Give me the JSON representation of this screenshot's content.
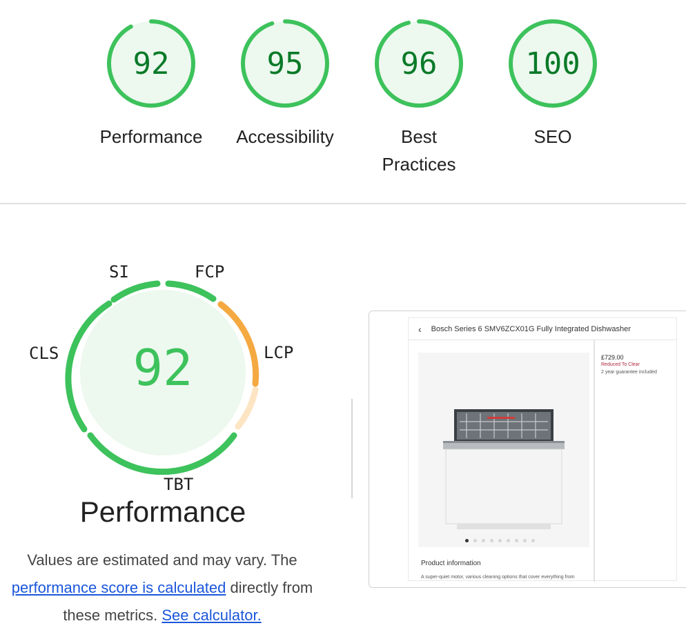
{
  "categories": [
    {
      "score": "92",
      "label": "Performance"
    },
    {
      "score": "95",
      "label": "Accessibility"
    },
    {
      "score": "96",
      "label_line1": "Best",
      "label_line2": "Practices"
    },
    {
      "score": "100",
      "label": "SEO"
    }
  ],
  "performance": {
    "score": "92",
    "title": "Performance",
    "metrics": {
      "si": "SI",
      "fcp": "FCP",
      "lcp": "LCP",
      "cls": "CLS",
      "tbt": "TBT"
    },
    "note_prefix": "Values are estimated and may vary. The",
    "note_link1": "performance score is calculated",
    "note_middle": "directly from",
    "note_line3": "these metrics.",
    "note_link2": "See calculator."
  },
  "preview": {
    "back_glyph": "‹",
    "title": "Bosch Series 6 SMV6ZCX01G Fully Integrated Dishwasher",
    "price": "£729.00",
    "reduced": "Reduced To Clear",
    "guarantee": "2 year guarantee included",
    "product_info_title": "Product information",
    "product_info_body": "A super-quiet motor, various cleaning options that cover everything from"
  },
  "colors": {
    "pass_green": "#3dc25c",
    "pass_fill": "#edf8ef",
    "score_text": "#0a7a28",
    "average_orange": "#f4a941",
    "average_light": "#fde5c4",
    "link_blue": "#1a56db"
  }
}
